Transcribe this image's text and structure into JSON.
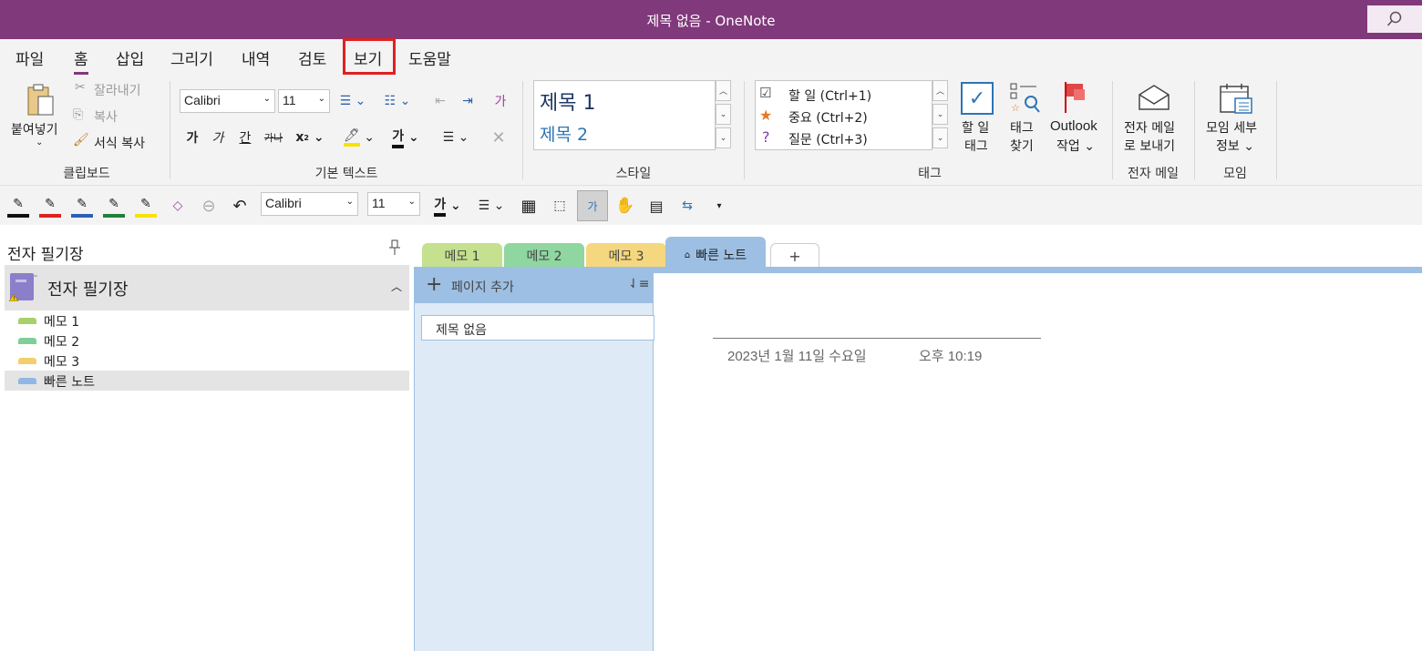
{
  "window": {
    "title": "제목 없음 - OneNote"
  },
  "menu": {
    "tabs": [
      "파일",
      "홈",
      "삽입",
      "그리기",
      "내역",
      "검토",
      "보기",
      "도움말"
    ],
    "active": "홈",
    "highlighted": "보기",
    "highlight_color": "#e02020"
  },
  "ribbon": {
    "clipboard": {
      "paste": "붙여넣기",
      "cut": "잘라내기",
      "copy": "복사",
      "format_painter": "서식 복사",
      "group": "클립보드"
    },
    "basic_text": {
      "font": "Calibri",
      "size": "11",
      "bold": "가",
      "italic": "가",
      "underline": "간",
      "strike": "가나",
      "subscript": "x",
      "font_color": "가",
      "style_clear": "가",
      "group": "기본 텍스트"
    },
    "styles": {
      "heading1": "제목 1",
      "heading2": "제목 2",
      "group": "스타일"
    },
    "tags": {
      "items": [
        {
          "label": "할 일 (Ctrl+1)",
          "icon": "checkbox-icon"
        },
        {
          "label": "중요 (Ctrl+2)",
          "icon": "star-icon"
        },
        {
          "label": "질문 (Ctrl+3)",
          "icon": "question-icon"
        }
      ],
      "todo_tag": [
        "할 일",
        "태그"
      ],
      "find_tags": [
        "태그",
        "찾기"
      ],
      "outlook": [
        "Outlook",
        "작업"
      ],
      "group": "태그"
    },
    "email": {
      "label": [
        "전자 메일",
        "로 보내기"
      ],
      "group": "전자 메일"
    },
    "meeting": {
      "label": [
        "모임 세부",
        "정보"
      ],
      "group": "모임"
    }
  },
  "quick_toolbar": {
    "font": "Calibri",
    "size": "11",
    "font_color": "가"
  },
  "nav": {
    "header": "전자 필기장",
    "notebook": "전자 필기장",
    "sections": [
      {
        "label": "메모 1",
        "color": "#a9d06b"
      },
      {
        "label": "메모 2",
        "color": "#7fcf97"
      },
      {
        "label": "메모 3",
        "color": "#f2cf6c"
      },
      {
        "label": "빠른 노트",
        "color": "#8fb8e4"
      }
    ]
  },
  "section_tabs": [
    {
      "label": "메모 1",
      "color": "#c5e08f"
    },
    {
      "label": "메모 2",
      "color": "#8fd6a0"
    },
    {
      "label": "메모 3",
      "color": "#f5d77f"
    },
    {
      "label": "빠른 노트",
      "color": "#9dbfe3"
    },
    {
      "label": "+",
      "color": "#ffffff"
    }
  ],
  "pages": {
    "add": "페이지 추가",
    "items": [
      "제목 없음"
    ]
  },
  "page": {
    "date": "2023년 1월 11일 수요일",
    "time": "오후 10:19"
  }
}
